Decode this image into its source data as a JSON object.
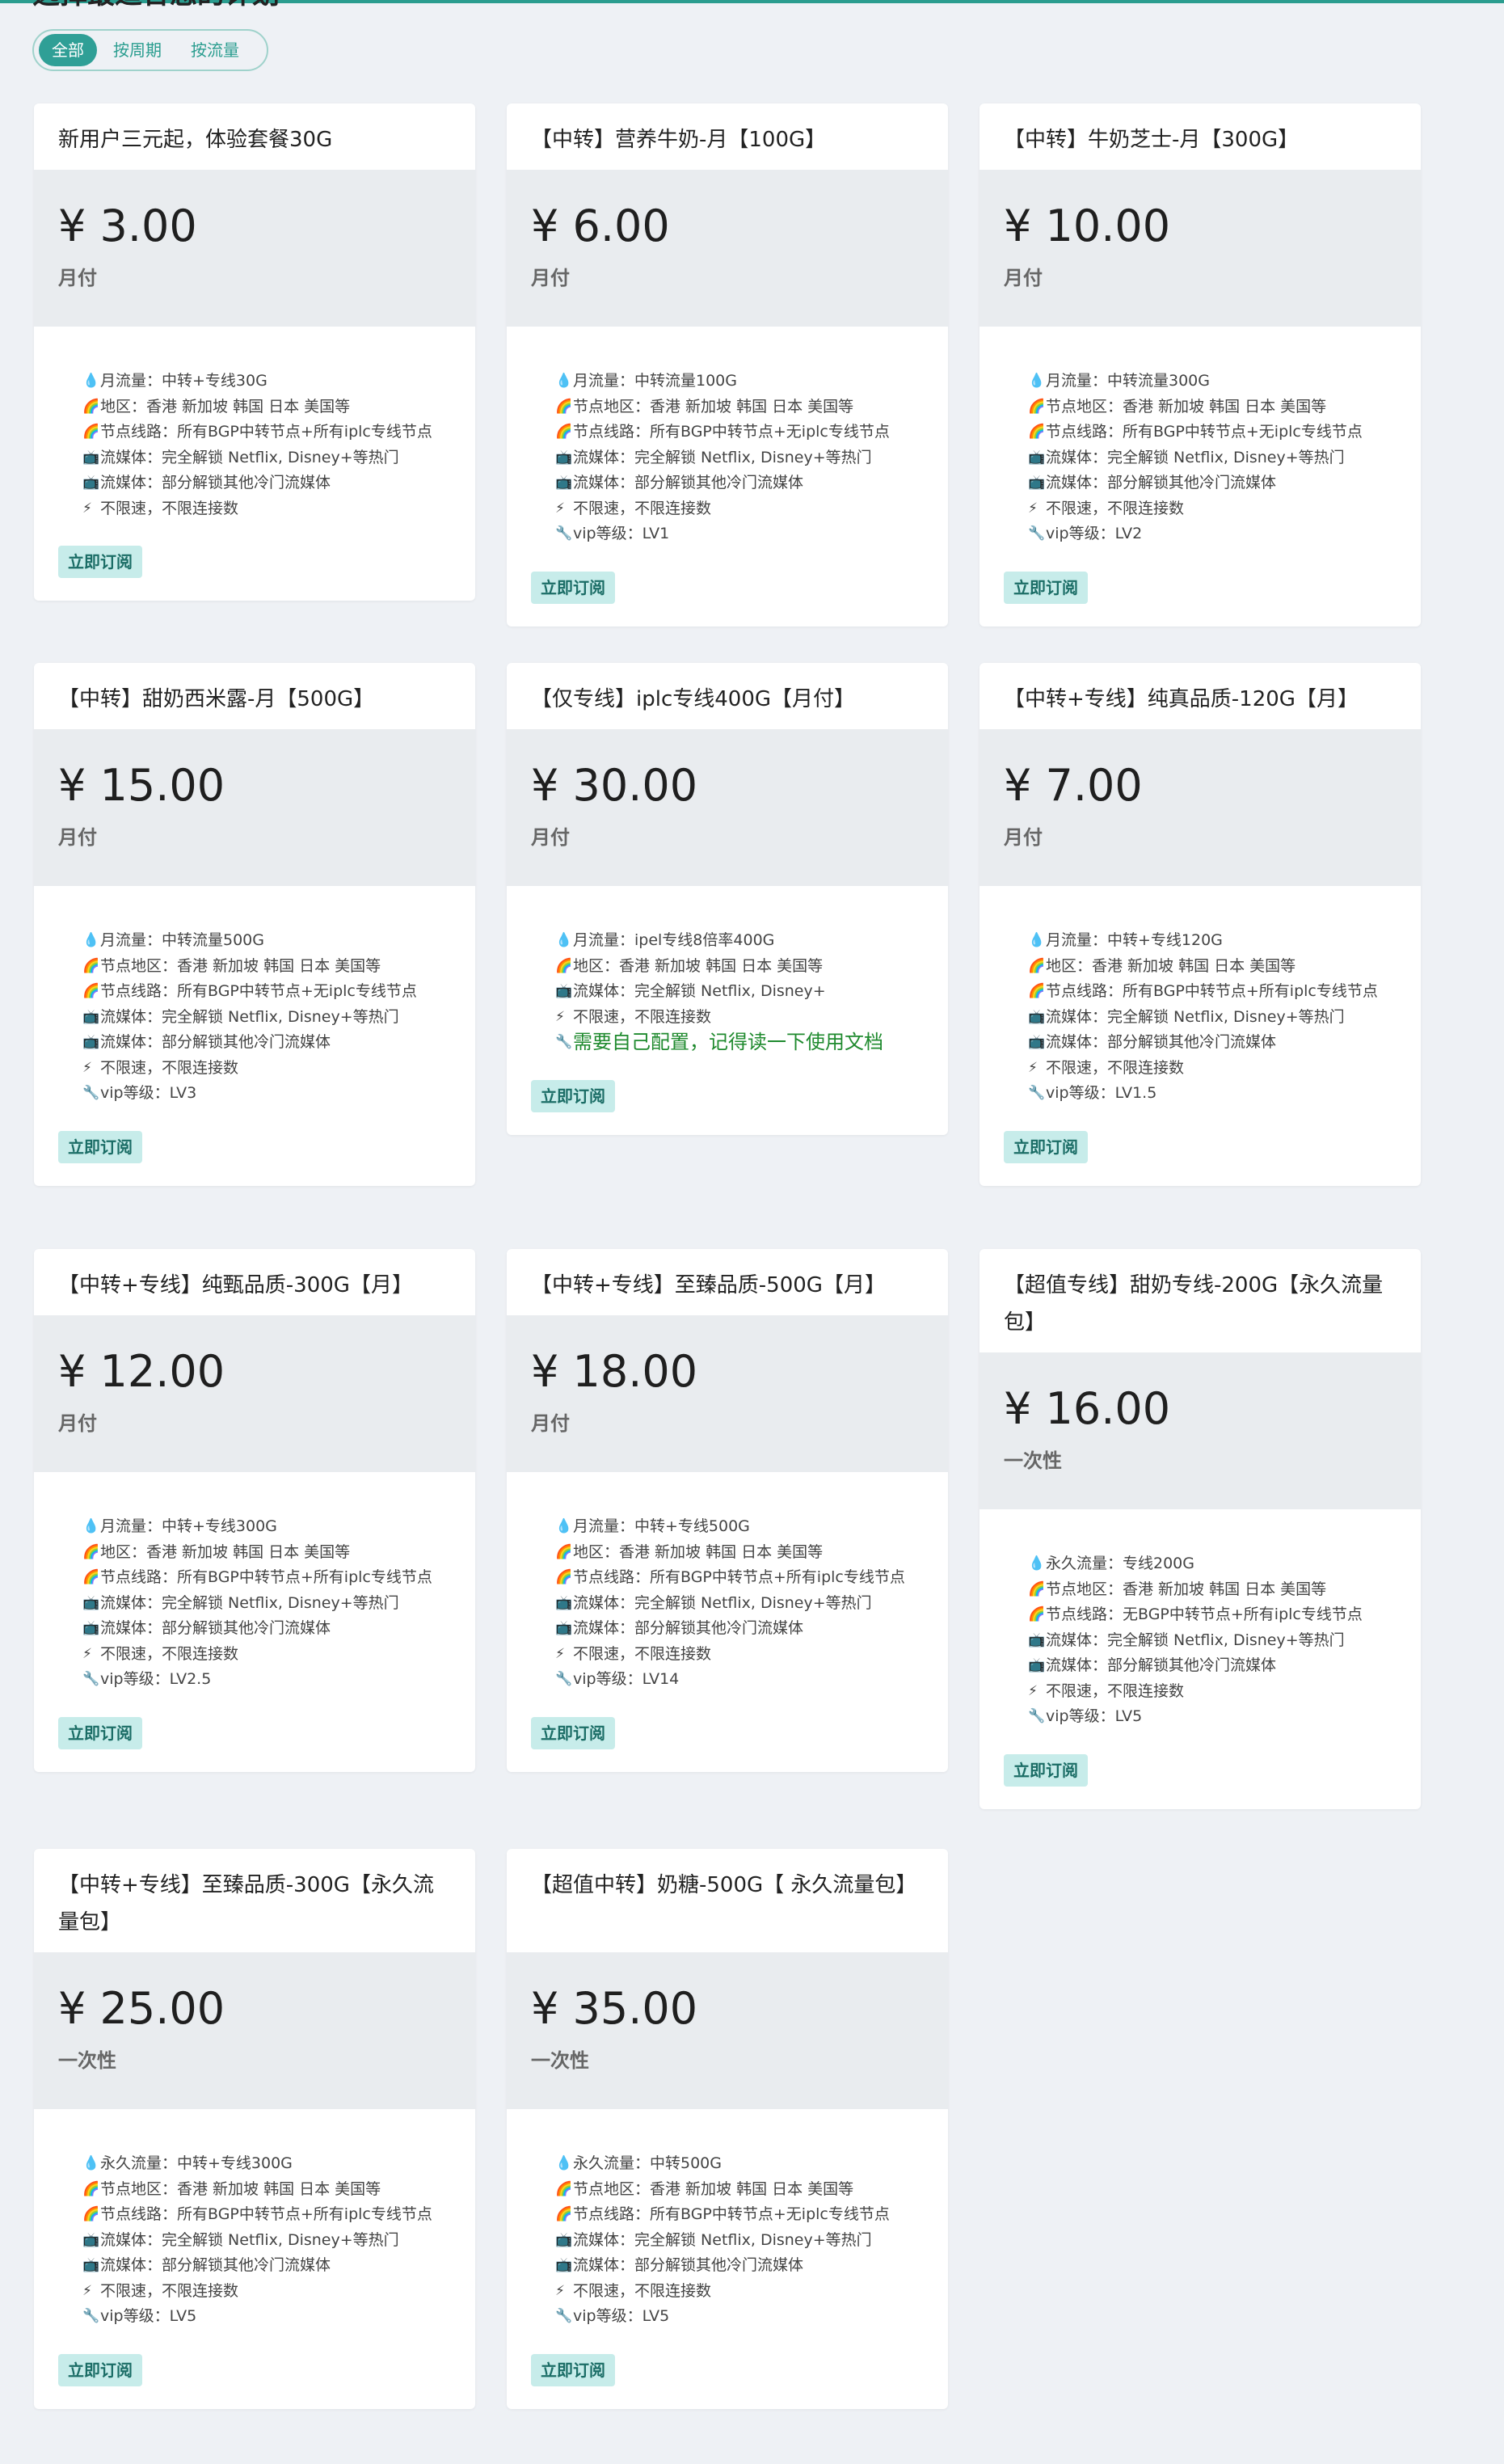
{
  "page": {
    "title": "选择最适合您的计划"
  },
  "filters": [
    "全部",
    "按周期",
    "按流量"
  ],
  "subscribe_label": "立即订阅",
  "icons": {
    "flow": "💧",
    "region": "🌈",
    "route": "🌈",
    "media": "📺",
    "speed": "⚡",
    "vip": "🔧"
  },
  "plans": [
    {
      "title": "新用户三元起，体验套餐30G",
      "price": "¥ 3.00",
      "period": "月付",
      "features": [
        {
          "icon": "flow",
          "text": "月流量：中转+专线30G"
        },
        {
          "icon": "region",
          "text": "地区：香港 新加坡 韩国 日本 美国等"
        },
        {
          "icon": "route",
          "text": "节点线路：所有BGP中转节点+所有iplc专线节点"
        },
        {
          "icon": "media",
          "text": "流媒体：完全解锁 Netflix, Disney+等热门"
        },
        {
          "icon": "media",
          "text": "流媒体：部分解锁其他冷门流媒体"
        },
        {
          "icon": "speed",
          "text": "不限速，不限连接数"
        }
      ]
    },
    {
      "title": "【中转】营养牛奶-月【100G】",
      "price": "¥ 6.00",
      "period": "月付",
      "features": [
        {
          "icon": "flow",
          "text": "月流量：中转流量100G"
        },
        {
          "icon": "region",
          "text": "节点地区：香港 新加坡 韩国 日本 美国等"
        },
        {
          "icon": "route",
          "text": "节点线路：所有BGP中转节点+无iplc专线节点"
        },
        {
          "icon": "media",
          "text": "流媒体：完全解锁 Netflix, Disney+等热门"
        },
        {
          "icon": "media",
          "text": "流媒体：部分解锁其他冷门流媒体"
        },
        {
          "icon": "speed",
          "text": "不限速，不限连接数"
        },
        {
          "icon": "vip",
          "text": "vip等级：LV1"
        }
      ]
    },
    {
      "title": "【中转】牛奶芝士-月【300G】",
      "price": "¥ 10.00",
      "period": "月付",
      "features": [
        {
          "icon": "flow",
          "text": "月流量：中转流量300G"
        },
        {
          "icon": "region",
          "text": "节点地区：香港 新加坡 韩国 日本 美国等"
        },
        {
          "icon": "route",
          "text": "节点线路：所有BGP中转节点+无iplc专线节点"
        },
        {
          "icon": "media",
          "text": "流媒体：完全解锁 Netflix, Disney+等热门"
        },
        {
          "icon": "media",
          "text": "流媒体：部分解锁其他冷门流媒体"
        },
        {
          "icon": "speed",
          "text": "不限速，不限连接数"
        },
        {
          "icon": "vip",
          "text": "vip等级：LV2"
        }
      ]
    },
    {
      "title": "【中转】甜奶西米露-月【500G】",
      "price": "¥ 15.00",
      "period": "月付",
      "features": [
        {
          "icon": "flow",
          "text": "月流量：中转流量500G"
        },
        {
          "icon": "region",
          "text": "节点地区：香港 新加坡 韩国 日本 美国等"
        },
        {
          "icon": "route",
          "text": "节点线路：所有BGP中转节点+无iplc专线节点"
        },
        {
          "icon": "media",
          "text": "流媒体：完全解锁 Netflix, Disney+等热门"
        },
        {
          "icon": "media",
          "text": "流媒体：部分解锁其他冷门流媒体"
        },
        {
          "icon": "speed",
          "text": "不限速，不限连接数"
        },
        {
          "icon": "vip",
          "text": "vip等级：LV3"
        }
      ]
    },
    {
      "title": "【仅专线】iplc专线400G【月付】",
      "price": "¥ 30.00",
      "period": "月付",
      "features": [
        {
          "icon": "flow",
          "text": "月流量：ipel专线8倍率400G"
        },
        {
          "icon": "region",
          "text": "地区：香港 新加坡 韩国 日本 美国等"
        },
        {
          "icon": "media",
          "text": "流媒体：完全解锁 Netflix, Disney+"
        },
        {
          "icon": "speed",
          "text": "不限速，不限连接数"
        },
        {
          "icon": "vip",
          "text": "需要自己配置，记得读一下使用文档",
          "green": true
        }
      ]
    },
    {
      "title": "【中转+专线】纯真品质-120G【月】",
      "price": "¥ 7.00",
      "period": "月付",
      "features": [
        {
          "icon": "flow",
          "text": "月流量：中转+专线120G"
        },
        {
          "icon": "region",
          "text": "地区：香港 新加坡 韩国 日本 美国等"
        },
        {
          "icon": "route",
          "text": "节点线路：所有BGP中转节点+所有iplc专线节点"
        },
        {
          "icon": "media",
          "text": "流媒体：完全解锁 Netflix, Disney+等热门"
        },
        {
          "icon": "media",
          "text": "流媒体：部分解锁其他冷门流媒体"
        },
        {
          "icon": "speed",
          "text": "不限速，不限连接数"
        },
        {
          "icon": "vip",
          "text": "vip等级：LV1.5"
        }
      ]
    },
    {
      "title": "【中转+专线】纯甄品质-300G【月】",
      "price": "¥ 12.00",
      "period": "月付",
      "features": [
        {
          "icon": "flow",
          "text": "月流量：中转+专线300G"
        },
        {
          "icon": "region",
          "text": "地区：香港 新加坡 韩国 日本 美国等"
        },
        {
          "icon": "route",
          "text": "节点线路：所有BGP中转节点+所有iplc专线节点"
        },
        {
          "icon": "media",
          "text": "流媒体：完全解锁 Netflix, Disney+等热门"
        },
        {
          "icon": "media",
          "text": "流媒体：部分解锁其他冷门流媒体"
        },
        {
          "icon": "speed",
          "text": "不限速，不限连接数"
        },
        {
          "icon": "vip",
          "text": "vip等级：LV2.5"
        }
      ]
    },
    {
      "title": "【中转+专线】至臻品质-500G【月】",
      "price": "¥ 18.00",
      "period": "月付",
      "features": [
        {
          "icon": "flow",
          "text": "月流量：中转+专线500G"
        },
        {
          "icon": "region",
          "text": "地区：香港 新加坡 韩国 日本 美国等"
        },
        {
          "icon": "route",
          "text": "节点线路：所有BGP中转节点+所有iplc专线节点"
        },
        {
          "icon": "media",
          "text": "流媒体：完全解锁 Netflix, Disney+等热门"
        },
        {
          "icon": "media",
          "text": "流媒体：部分解锁其他冷门流媒体"
        },
        {
          "icon": "speed",
          "text": "不限速，不限连接数"
        },
        {
          "icon": "vip",
          "text": "vip等级：LV14"
        }
      ]
    },
    {
      "title": "【超值专线】甜奶专线-200G【永久流量包】",
      "price": "¥ 16.00",
      "period": "一次性",
      "features": [
        {
          "icon": "flow",
          "text": "永久流量：专线200G"
        },
        {
          "icon": "region",
          "text": "节点地区：香港 新加坡 韩国 日本 美国等"
        },
        {
          "icon": "route",
          "text": "节点线路：无BGP中转节点+所有iplc专线节点"
        },
        {
          "icon": "media",
          "text": "流媒体：完全解锁 Netflix, Disney+等热门"
        },
        {
          "icon": "media",
          "text": "流媒体：部分解锁其他冷门流媒体"
        },
        {
          "icon": "speed",
          "text": "不限速，不限连接数"
        },
        {
          "icon": "vip",
          "text": "vip等级：LV5"
        }
      ]
    },
    {
      "title": "【中转+专线】至臻品质-300G【永久流量包】",
      "price": "¥ 25.00",
      "period": "一次性",
      "features": [
        {
          "icon": "flow",
          "text": "永久流量：中转+专线300G"
        },
        {
          "icon": "region",
          "text": "节点地区：香港 新加坡 韩国 日本 美国等"
        },
        {
          "icon": "route",
          "text": "节点线路：所有BGP中转节点+所有iplc专线节点"
        },
        {
          "icon": "media",
          "text": "流媒体：完全解锁 Netflix, Disney+等热门"
        },
        {
          "icon": "media",
          "text": "流媒体：部分解锁其他冷门流媒体"
        },
        {
          "icon": "speed",
          "text": "不限速，不限连接数"
        },
        {
          "icon": "vip",
          "text": "vip等级：LV5"
        }
      ]
    },
    {
      "title": "【超值中转】奶糖-500G【 永久流量包】",
      "price": "¥ 35.00",
      "period": "一次性",
      "features": [
        {
          "icon": "flow",
          "text": "永久流量：中转500G"
        },
        {
          "icon": "region",
          "text": "节点地区：香港 新加坡 韩国 日本 美国等"
        },
        {
          "icon": "route",
          "text": "节点线路：所有BGP中转节点+无iplc专线节点"
        },
        {
          "icon": "media",
          "text": "流媒体：完全解锁 Netflix, Disney+等热门"
        },
        {
          "icon": "media",
          "text": "流媒体：部分解锁其他冷门流媒体"
        },
        {
          "icon": "speed",
          "text": "不限速，不限连接数"
        },
        {
          "icon": "vip",
          "text": "vip等级：LV5"
        }
      ]
    }
  ]
}
